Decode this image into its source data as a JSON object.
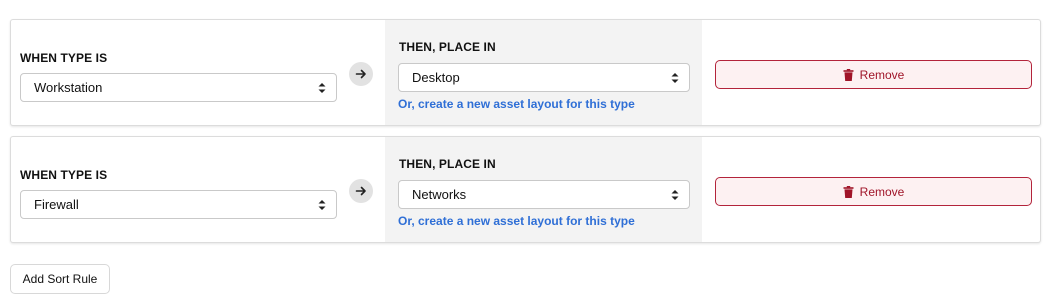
{
  "rules": [
    {
      "when_label": "WHEN TYPE IS",
      "when_value": "Workstation",
      "then_label": "THEN, PLACE IN",
      "then_value": "Desktop",
      "create_link": "Or, create a new asset layout for this type",
      "remove_label": "Remove"
    },
    {
      "when_label": "WHEN TYPE IS",
      "when_value": "Firewall",
      "then_label": "THEN, PLACE IN",
      "then_value": "Networks",
      "create_link": "Or, create a new asset layout for this type",
      "remove_label": "Remove"
    }
  ],
  "add_rule_label": "Add Sort Rule",
  "icons": {
    "select": "chevron-updown-icon",
    "arrow": "arrow-right-icon",
    "remove": "trash-icon"
  },
  "colors": {
    "danger": "#a01529",
    "danger_bg": "#fdf1f2",
    "link": "#2f6fd6",
    "then_bg": "#f3f3f3"
  }
}
